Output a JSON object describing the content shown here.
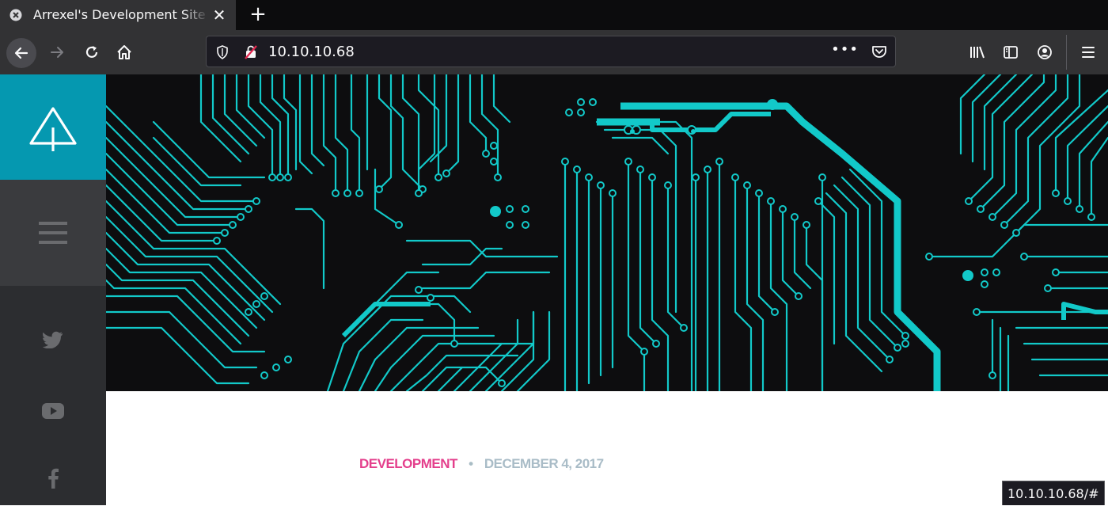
{
  "browser": {
    "tab": {
      "title": "Arrexel's Development Site",
      "close_icon": "close-icon",
      "favicon": "site-favicon"
    },
    "new_tab_label": "+",
    "url": "10.10.10.68",
    "page_actions_label": "•••",
    "status_url": "10.10.10.68/#"
  },
  "sidebar": {
    "logo": "tree-logo-icon",
    "menu": "hamburger-icon",
    "social": [
      "twitter-icon",
      "youtube-icon",
      "facebook-icon"
    ]
  },
  "post": {
    "category": "DEVELOPMENT",
    "separator": "•",
    "date": "DECEMBER 4, 2017"
  },
  "colors": {
    "accent": "#0598b0",
    "circuit": "#12c9c9",
    "category": "#e43f8c"
  }
}
